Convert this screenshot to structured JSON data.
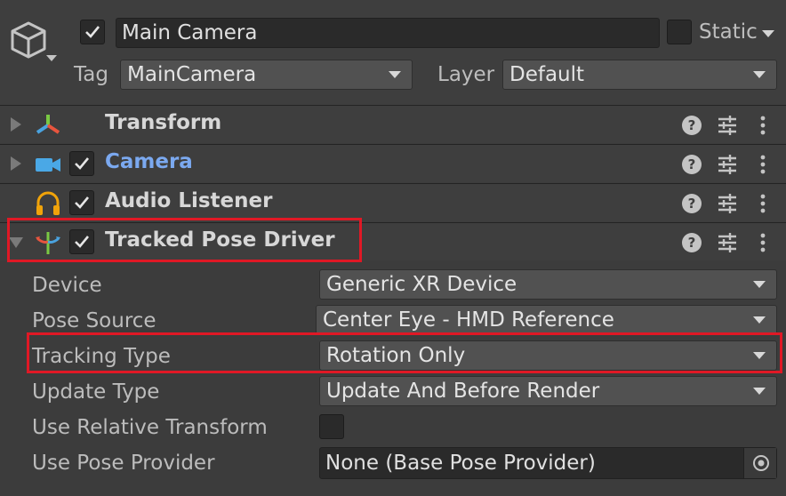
{
  "header": {
    "active_checked": true,
    "object_name": "Main Camera",
    "static_label": "Static",
    "tag_label": "Tag",
    "tag_value": "MainCamera",
    "layer_label": "Layer",
    "layer_value": "Default"
  },
  "components": [
    {
      "title": "Transform",
      "icon": "transform-axes-icon",
      "has_checkbox": false
    },
    {
      "title": "Camera",
      "icon": "camera-icon",
      "has_checkbox": true,
      "checked": true
    },
    {
      "title": "Audio Listener",
      "icon": "headphones-icon",
      "has_checkbox": true,
      "checked": true
    },
    {
      "title": "Tracked Pose Driver",
      "icon": "tracked-pose-driver-icon",
      "has_checkbox": true,
      "checked": true,
      "expanded": true
    }
  ],
  "properties": {
    "device": {
      "label": "Device",
      "value": "Generic XR Device"
    },
    "pose_source": {
      "label": "Pose Source",
      "value": "Center Eye - HMD Reference"
    },
    "tracking_type": {
      "label": "Tracking Type",
      "value": "Rotation Only"
    },
    "update_type": {
      "label": "Update Type",
      "value": "Update And Before Render"
    },
    "use_relative_transform": {
      "label": "Use Relative Transform",
      "checked": false
    },
    "use_pose_provider": {
      "label": "Use Pose Provider",
      "value": "None (Base Pose Provider)"
    }
  },
  "colors": {
    "highlight": "#e01825",
    "camera_title": "#7ba9f0",
    "background": "#3c3c3c"
  }
}
